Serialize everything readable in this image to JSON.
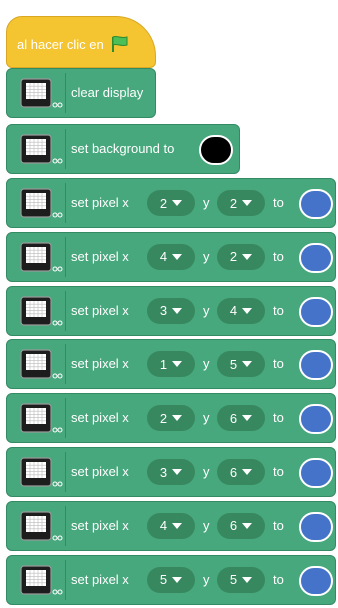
{
  "hat": {
    "label": "al hacer clic en",
    "icon": "green-flag-icon"
  },
  "clear_block": {
    "label": "clear display",
    "icon": "microbit-icon"
  },
  "background_block": {
    "label": "set background to",
    "color": "#000000",
    "icon": "microbit-icon"
  },
  "pixel_blocks": [
    {
      "label": "set pixel x",
      "x": "2",
      "y_label": "y",
      "y": "2",
      "to_label": "to",
      "color": "#4473c9"
    },
    {
      "label": "set pixel x",
      "x": "4",
      "y_label": "y",
      "y": "2",
      "to_label": "to",
      "color": "#4473c9"
    },
    {
      "label": "set pixel x",
      "x": "3",
      "y_label": "y",
      "y": "4",
      "to_label": "to",
      "color": "#4473c9"
    },
    {
      "label": "set pixel x",
      "x": "1",
      "y_label": "y",
      "y": "5",
      "to_label": "to",
      "color": "#4473c9"
    },
    {
      "label": "set pixel x",
      "x": "2",
      "y_label": "y",
      "y": "6",
      "to_label": "to",
      "color": "#4473c9"
    },
    {
      "label": "set pixel x",
      "x": "3",
      "y_label": "y",
      "y": "6",
      "to_label": "to",
      "color": "#4473c9"
    },
    {
      "label": "set pixel x",
      "x": "4",
      "y_label": "y",
      "y": "6",
      "to_label": "to",
      "color": "#4473c9"
    },
    {
      "label": "set pixel x",
      "x": "5",
      "y_label": "y",
      "y": "5",
      "to_label": "to",
      "color": "#4473c9"
    }
  ]
}
